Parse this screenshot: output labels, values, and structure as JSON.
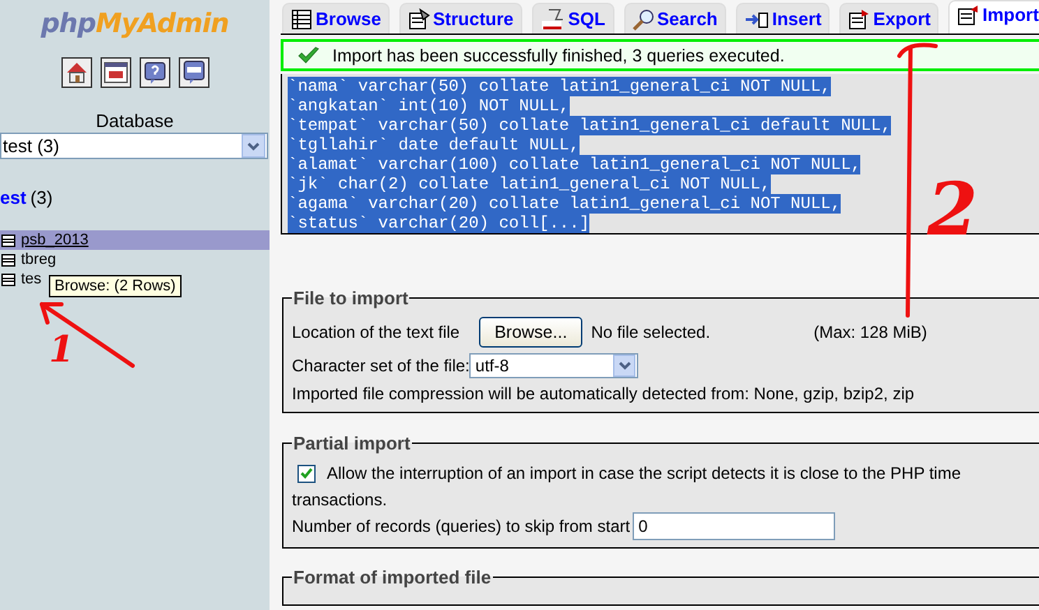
{
  "sidebar": {
    "logo": {
      "prefix": "php",
      "name": "MyAdmin"
    },
    "database_label": "Database",
    "database_select": {
      "value": "test (3)"
    },
    "database_link": {
      "name": "est",
      "count": "(3)"
    },
    "tables": [
      {
        "name": "psb_2013",
        "selected": true
      },
      {
        "name": "tbreg",
        "selected": false
      },
      {
        "name": "tes",
        "selected": false
      }
    ],
    "tooltip": "Browse:  (2 Rows)"
  },
  "tabs": [
    {
      "label": "Browse",
      "kind": "browse",
      "selected": false
    },
    {
      "label": "Structure",
      "kind": "structure",
      "selected": false
    },
    {
      "label": "SQL",
      "kind": "sql",
      "selected": false
    },
    {
      "label": "Search",
      "kind": "search",
      "selected": false
    },
    {
      "label": "Insert",
      "kind": "insert",
      "selected": false
    },
    {
      "label": "Export",
      "kind": "export",
      "selected": false
    },
    {
      "label": "Import",
      "kind": "import",
      "selected": true
    }
  ],
  "message": "Import has been successfully finished, 3 queries executed.",
  "sql_lines": [
    "`nama` varchar(50) collate latin1_general_ci NOT NULL,",
    "`angkatan` int(10) NOT NULL,",
    "`tempat` varchar(50) collate latin1_general_ci default NULL,",
    "`tgllahir` date default NULL,",
    "`alamat` varchar(100) collate latin1_general_ci NOT NULL,",
    "`jk` char(2) collate latin1_general_ci NOT NULL,",
    "`agama` varchar(20) collate latin1_general_ci NOT NULL,",
    "`status` varchar(20) coll[...]"
  ],
  "file_to_import": {
    "legend": "File to import",
    "location_label": "Location of the text file",
    "browse_button": "Browse...",
    "file_status": "No file selected.",
    "max_size": "(Max: 128 MiB)",
    "charset_label": "Character set of the file:",
    "charset_value": "utf-8",
    "compression_note": "Imported file compression will be automatically detected from: None, gzip, bzip2, zip"
  },
  "partial_import": {
    "legend": "Partial import",
    "allow_interrupt": {
      "label": "Allow the interruption of an import in case the script detects it is close to the PHP time",
      "continuation": "transactions.",
      "checked": true
    },
    "skip_label": "Number of records (queries) to skip from start",
    "skip_value": "0"
  },
  "format": {
    "legend": "Format of imported file"
  },
  "annotations": [
    {
      "label": "1"
    },
    {
      "label": "2"
    }
  ]
}
